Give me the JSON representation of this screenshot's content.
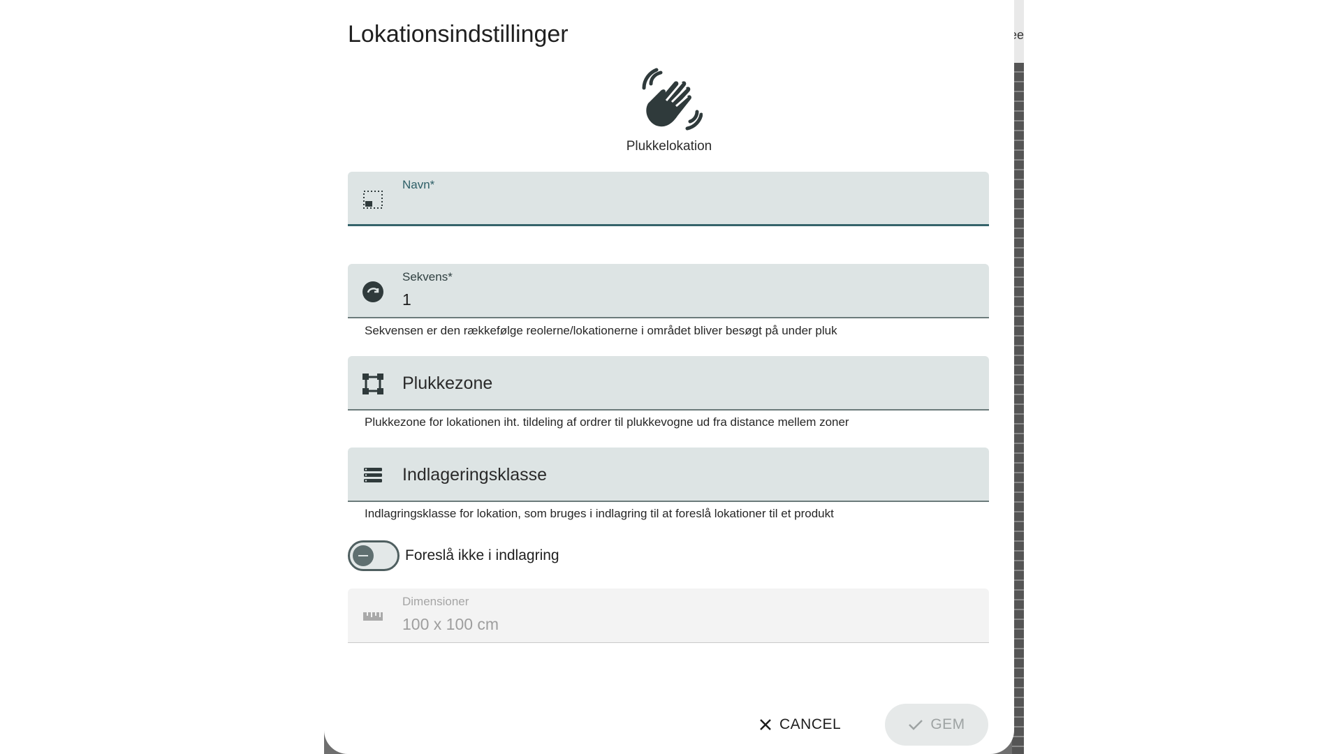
{
  "dialog": {
    "title": "Lokationsindstillinger",
    "hero_icon": "waving-hand-icon",
    "hero_label": "Plukkelokation"
  },
  "fields": {
    "name": {
      "label": "Navn*",
      "value": "",
      "icon": "location-frame-icon"
    },
    "sequence": {
      "label": "Sekvens*",
      "value": "1",
      "icon": "sequence-icon",
      "helper": "Sekvensen er den rækkefølge reolerne/lokationerne i området bliver besøgt på under pluk"
    },
    "pick_zone": {
      "label": "Plukkezone",
      "icon": "zone-icon",
      "helper": "Plukkezone for lokationen iht. tildeling af ordrer til plukkevogne ud fra distance mellem zoner"
    },
    "storage_class": {
      "label": "Indlageringsklasse",
      "icon": "list-icon",
      "helper": "Indlagringsklasse for lokation, som bruges i indlagring til at foreslå lokationer til et produkt"
    },
    "dimensions": {
      "label": "Dimensioner",
      "value": "100 x 100 cm",
      "icon": "ruler-icon"
    }
  },
  "toggle": {
    "label": "Foreslå ikke i indlagring",
    "checked": false
  },
  "actions": {
    "cancel_label": "CANCEL",
    "save_label": "GEM"
  },
  "backdrop": {
    "partial_text": "ee"
  },
  "colors": {
    "field_bg": "#dde4e4",
    "accent": "#35636a",
    "icon": "#2f3a3b"
  }
}
